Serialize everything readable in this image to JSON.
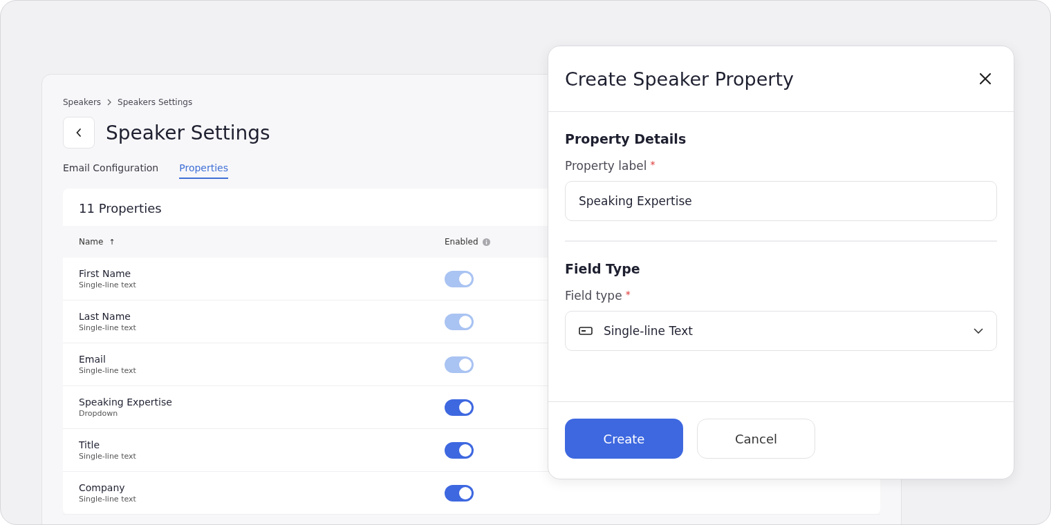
{
  "breadcrumb": [
    {
      "label": "Speakers"
    },
    {
      "label": "Speakers Settings"
    }
  ],
  "page": {
    "title": "Speaker Settings"
  },
  "tabs": [
    {
      "label": "Email Configuration",
      "selected": false
    },
    {
      "label": "Properties",
      "selected": true
    }
  ],
  "table": {
    "title": "11 Properties",
    "columns": [
      {
        "label": "Name",
        "sort": "↑"
      },
      {
        "label": "Enabled"
      }
    ],
    "rows": [
      {
        "name": "First Name",
        "type": "Single-line text",
        "on": true,
        "disabled": true
      },
      {
        "name": "Last Name",
        "type": "Single-line text",
        "on": true,
        "disabled": true
      },
      {
        "name": "Email",
        "type": "Single-line text",
        "on": true,
        "disabled": true
      },
      {
        "name": "Speaking Expertise",
        "type": "Dropdown",
        "on": true,
        "disabled": false
      },
      {
        "name": "Title",
        "type": "Single-line text",
        "on": true,
        "disabled": false
      },
      {
        "name": "Company",
        "type": "Single-line text",
        "on": true,
        "disabled": false
      }
    ]
  },
  "dialog": {
    "title": "Create Speaker Property",
    "sections": [
      {
        "heading": "Property Details",
        "label": "Property label",
        "required_mark": "*",
        "kind": "input",
        "value": "Speaking Expertise"
      },
      {
        "heading": "Field Type",
        "label": "Field type",
        "required_mark": "*",
        "kind": "select",
        "value": "Single-line Text"
      }
    ],
    "buttons": [
      {
        "label": "Create",
        "kind": "primary"
      },
      {
        "label": "Cancel",
        "kind": "secondary"
      }
    ]
  }
}
